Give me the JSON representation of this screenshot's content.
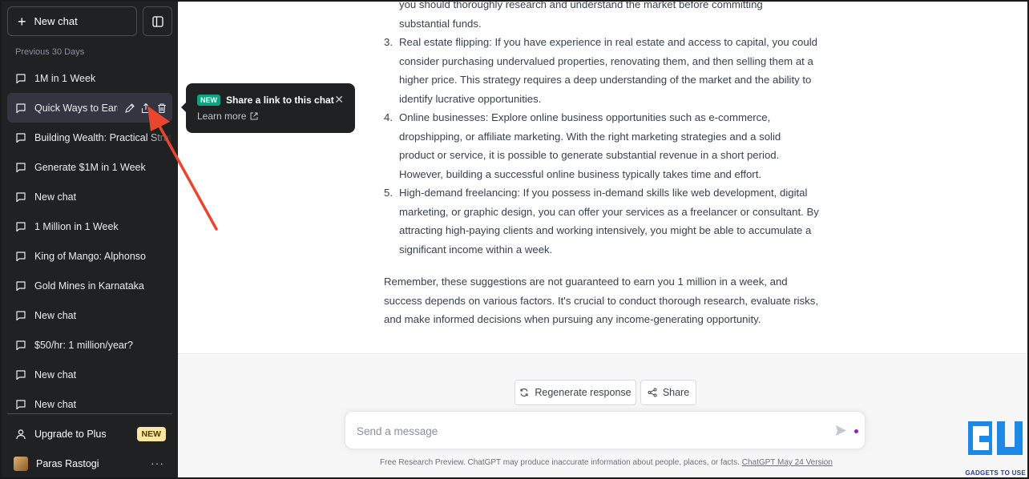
{
  "sidebar": {
    "new_chat_label": "New chat",
    "section_label": "Previous 30 Days",
    "items": [
      {
        "label": "1M in 1 Week"
      },
      {
        "label": "Quick Ways to Earn"
      },
      {
        "label": "Building Wealth: Practical Strategies"
      },
      {
        "label": "Generate $1M in 1 Week"
      },
      {
        "label": "New chat"
      },
      {
        "label": "1 Million in 1 Week"
      },
      {
        "label": "King of Mango: Alphonso"
      },
      {
        "label": "Gold Mines in Karnataka"
      },
      {
        "label": "New chat"
      },
      {
        "label": "$50/hr: 1 million/year?"
      },
      {
        "label": "New chat"
      },
      {
        "label": "New chat"
      }
    ],
    "upgrade_label": "Upgrade to Plus",
    "upgrade_badge": "NEW",
    "user_name": "Paras Rastogi"
  },
  "tooltip": {
    "badge": "NEW",
    "title": "Share a link to this chat",
    "learn_more": "Learn more"
  },
  "answer": {
    "items": [
      {
        "num": "",
        "lines": [
          "you should thoroughly research and understand the market before committing",
          "substantial funds."
        ]
      },
      {
        "num": "3.",
        "lines": [
          "Real estate flipping: If you have experience in real estate and access to capital, you could",
          "consider purchasing undervalued properties, renovating them, and then selling them at a",
          "higher price. This strategy requires a deep understanding of the market and the ability to",
          "identify lucrative opportunities."
        ]
      },
      {
        "num": "4.",
        "lines": [
          "Online businesses: Explore online business opportunities such as e-commerce,",
          "dropshipping, or affiliate marketing. With the right marketing strategies and a solid",
          "product or service, it is possible to generate substantial revenue in a short period.",
          "However, building a successful online business typically takes time and effort."
        ]
      },
      {
        "num": "5.",
        "lines": [
          "High-demand freelancing: If you possess in-demand skills like web development, digital",
          "marketing, or graphic design, you can offer your services as a freelancer or consultant. By",
          "attracting high-paying clients and working intensively, you might be able to accumulate a",
          "significant income within a week."
        ]
      }
    ],
    "closing": [
      "Remember, these suggestions are not guaranteed to earn you 1 million in a week, and",
      "success depends on various factors. It's crucial to conduct thorough research, evaluate risks,",
      "and make informed decisions when pursuing any income-generating opportunity."
    ]
  },
  "actions": {
    "regenerate_label": "Regenerate response",
    "share_label": "Share"
  },
  "composer": {
    "placeholder": "Send a message"
  },
  "footer": {
    "text": "Free Research Preview. ChatGPT may produce inaccurate information about people, places, or facts.",
    "link": "ChatGPT May 24 Version"
  },
  "watermark": {
    "text": "GADGETS TO USE"
  },
  "colors": {
    "sidebar_bg": "#202123",
    "accent_green": "#10a37f",
    "badge_yellow": "#fae69e",
    "arrow_red": "#e8472f"
  }
}
